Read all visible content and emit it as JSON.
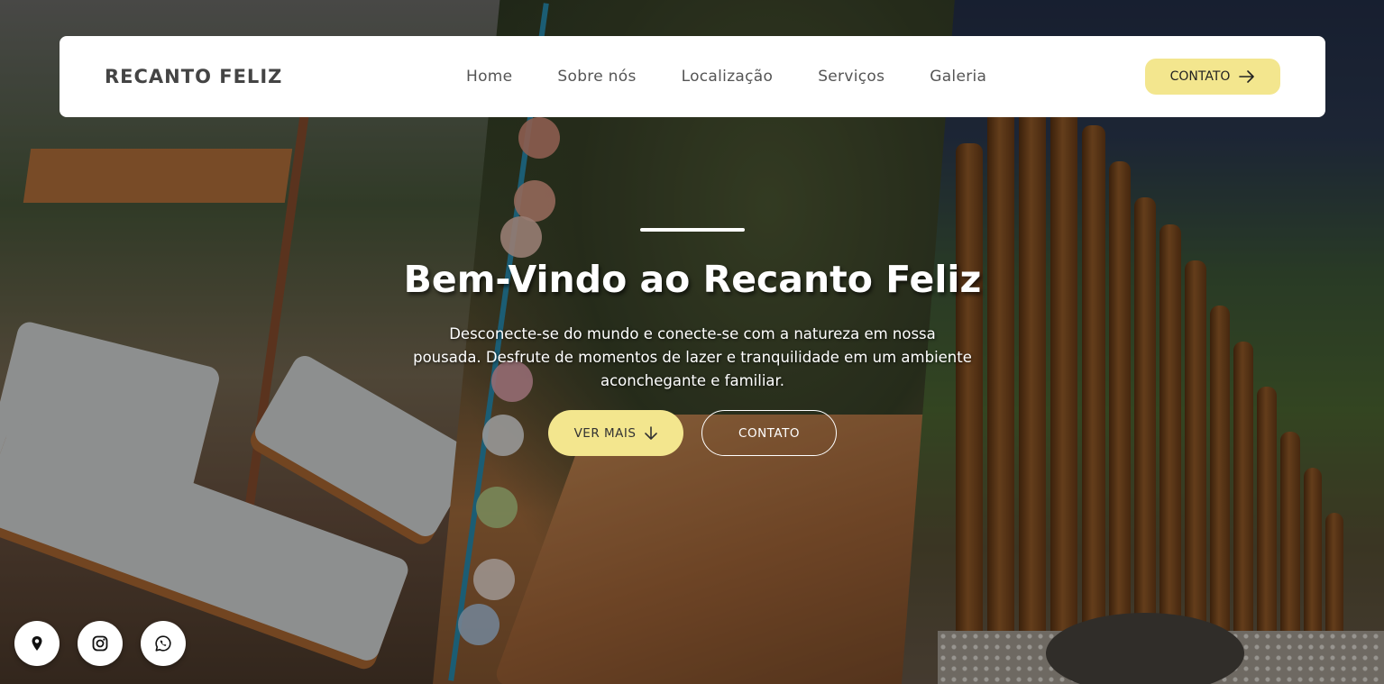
{
  "navbar": {
    "brand": "RECANTO FELIZ",
    "links": [
      {
        "label": "Home"
      },
      {
        "label": "Sobre nós"
      },
      {
        "label": "Localização"
      },
      {
        "label": "Serviços"
      },
      {
        "label": "Galeria"
      }
    ],
    "cta_label": "CONTATO",
    "cta_icon": "arrow-right-icon"
  },
  "hero": {
    "title": "Bem-Vindo ao Recanto Feliz",
    "subtitle": "Desconecte-se do mundo e conecte-se com a natureza em nossa pousada. Desfrute de momentos de lazer e tranquilidade em um ambiente aconchegante e familiar.",
    "primary_button": {
      "label": "VER MAIS",
      "icon": "arrow-down-icon"
    },
    "secondary_button": {
      "label": "CONTATO"
    }
  },
  "social": [
    {
      "icon": "location-pin-icon"
    },
    {
      "icon": "instagram-icon"
    },
    {
      "icon": "whatsapp-icon"
    }
  ],
  "colors": {
    "accent": "#f3e68e",
    "navbar_bg": "#ffffff",
    "brand_text": "#444444",
    "nav_text": "#555555",
    "hero_text": "#ffffff"
  }
}
